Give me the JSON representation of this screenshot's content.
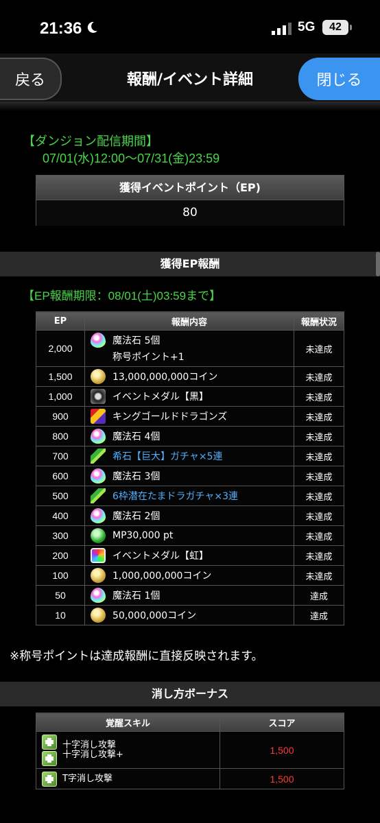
{
  "status_bar": {
    "time": "21:36",
    "network": "5G",
    "battery": "42"
  },
  "nav": {
    "back_label": "戻る",
    "title": "報酬/イベント詳細",
    "close_label": "閉じる"
  },
  "dungeon": {
    "period_label": "【ダンジョン配信期間】",
    "period_value": "07/01(水)12:00〜07/31(金)23:59"
  },
  "ep_box": {
    "header": "獲得イベントポイント（EP)",
    "value": "80"
  },
  "ep_rewards": {
    "section_title": "獲得EP報酬",
    "limit_text": "【EP報酬期限：08/01(土)03:59まで】",
    "columns": [
      "EP",
      "報酬内容",
      "報酬状況"
    ],
    "rows": [
      {
        "ep": "2,000",
        "icon": "magic-stone-icon",
        "reward": "魔法石 5個",
        "sub": "称号ポイント+1",
        "status": "未達成"
      },
      {
        "ep": "1,500",
        "icon": "coin-icon",
        "reward": "13,000,000,000コイン",
        "status": "未達成"
      },
      {
        "ep": "1,000",
        "icon": "event-medal-black-icon",
        "reward": "イベントメダル【黒】",
        "status": "未達成"
      },
      {
        "ep": "900",
        "icon": "king-gold-dragons-icon",
        "reward": "キングゴールドドラゴンズ",
        "status": "未達成"
      },
      {
        "ep": "800",
        "icon": "magic-stone-icon",
        "reward": "魔法石 4個",
        "status": "未達成"
      },
      {
        "ep": "700",
        "icon": "dragon-icon",
        "reward": "希石【巨大】ガチャ×5連",
        "status": "未達成",
        "link": true
      },
      {
        "ep": "600",
        "icon": "magic-stone-icon",
        "reward": "魔法石 3個",
        "status": "未達成"
      },
      {
        "ep": "500",
        "icon": "dragon-icon",
        "reward": "6枠潜在たまドラガチャ×3連",
        "status": "未達成",
        "link": true
      },
      {
        "ep": "400",
        "icon": "magic-stone-icon",
        "reward": "魔法石 2個",
        "status": "未達成"
      },
      {
        "ep": "300",
        "icon": "mp-icon",
        "reward": "MP30,000 pt",
        "status": "未達成"
      },
      {
        "ep": "200",
        "icon": "event-medal-rainbow-icon",
        "reward": "イベントメダル【虹】",
        "status": "未達成"
      },
      {
        "ep": "100",
        "icon": "coin-icon",
        "reward": "1,000,000,000コイン",
        "status": "未達成"
      },
      {
        "ep": "50",
        "icon": "magic-stone-icon",
        "reward": "魔法石 1個",
        "status": "達成"
      },
      {
        "ep": "10",
        "icon": "coin-icon",
        "reward": "50,000,000コイン",
        "status": "達成"
      }
    ]
  },
  "note": "※称号ポイントは達成報酬に直接反映されます。",
  "bonus": {
    "section_title": "消し方ボーナス",
    "columns": [
      "覚醒スキル",
      "スコア"
    ],
    "rows": [
      {
        "skills": [
          "十字消し攻撃",
          "十字消し攻撃+"
        ],
        "score": "1,500"
      },
      {
        "skills": [
          "T字消し攻撃"
        ],
        "score": "1,500"
      }
    ]
  },
  "colors": {
    "accent_blue": "#3b95f0",
    "period_green": "#48d648",
    "link_blue": "#4fb0ff",
    "score_red": "#ff3b3b"
  }
}
